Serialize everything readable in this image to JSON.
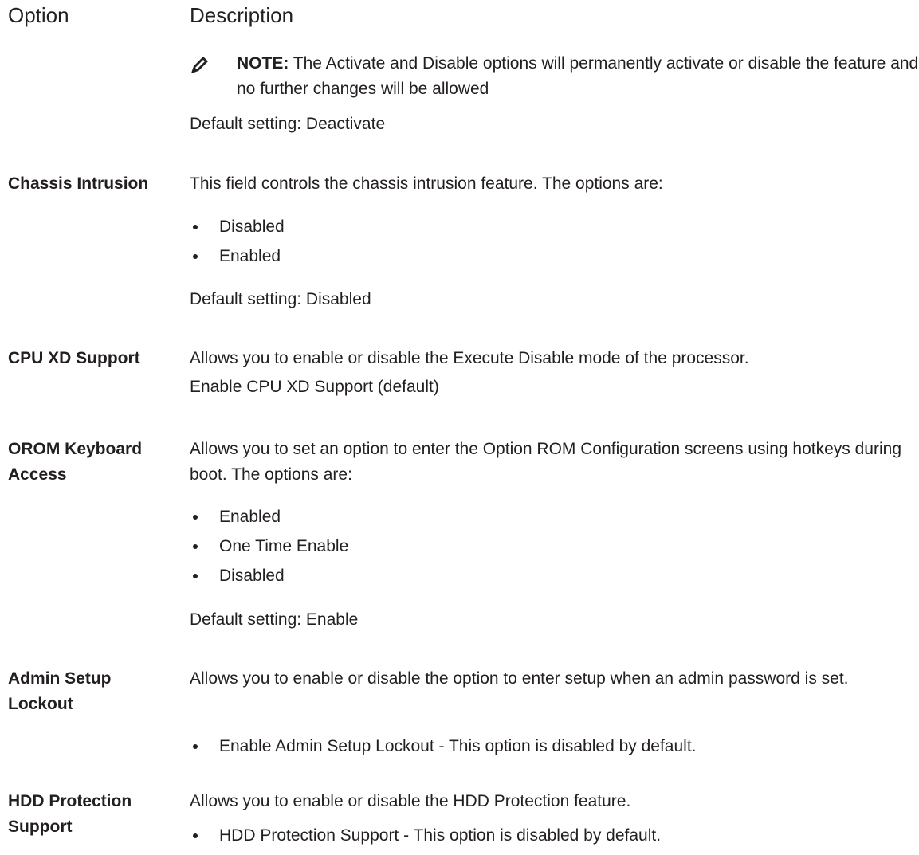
{
  "header": {
    "option": "Option",
    "description": "Description"
  },
  "note": {
    "label": "NOTE:",
    "text": " The Activate and Disable options will permanently activate or disable the feature and no further changes will be allowed",
    "icon": "pencil-note-icon"
  },
  "tpm_default": "Default setting: Deactivate",
  "rows": {
    "chassis": {
      "label": "Chassis Intrusion",
      "description": "This field controls the chassis intrusion feature. The options are:",
      "options": [
        "Disabled",
        "Enabled"
      ],
      "default": "Default setting: Disabled"
    },
    "cpu_xd": {
      "label": "CPU XD Support",
      "description": "Allows you to enable or disable the Execute Disable mode of the processor.",
      "default": "Enable CPU XD Support (default)"
    },
    "orom": {
      "label": "OROM Keyboard Access",
      "description": "Allows you to set an option to enter the Option ROM Configuration screens using hotkeys during boot. The options are:",
      "options": [
        "Enabled",
        "One Time Enable",
        "Disabled"
      ],
      "default": "Default setting: Enable"
    },
    "admin_lockout": {
      "label": "Admin Setup Lockout",
      "description": "Allows you to enable or disable the option to enter setup when an admin password is set.",
      "options": [
        "Enable Admin Setup Lockout - This option is disabled by default."
      ]
    },
    "hdd_protection": {
      "label": "HDD Protection Support",
      "description": "Allows you to enable or disable the HDD Protection feature.",
      "options": [
        "HDD Protection Support - This option is disabled by default."
      ]
    }
  }
}
